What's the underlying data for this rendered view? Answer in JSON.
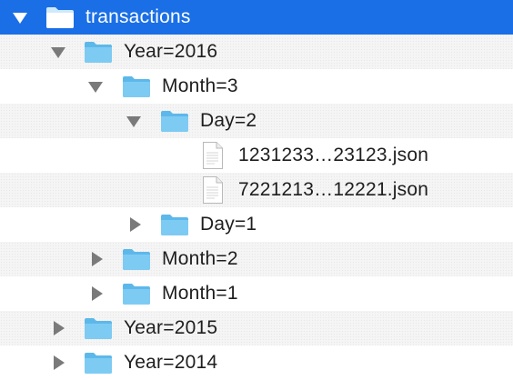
{
  "tree": {
    "root": {
      "label": "transactions",
      "icon": "folder-icon",
      "expanded": true,
      "selected": true
    },
    "year_2016": {
      "label": "Year=2016",
      "icon": "folder-icon",
      "expanded": true
    },
    "month_3": {
      "label": "Month=3",
      "icon": "folder-icon",
      "expanded": true
    },
    "day_2": {
      "label": "Day=2",
      "icon": "folder-icon",
      "expanded": true
    },
    "file_1": {
      "label": "1231233…23123.json",
      "icon": "json-file-icon"
    },
    "file_2": {
      "label": "7221213…12221.json",
      "icon": "json-file-icon"
    },
    "day_1": {
      "label": "Day=1",
      "icon": "folder-icon",
      "expanded": false
    },
    "month_2": {
      "label": "Month=2",
      "icon": "folder-icon",
      "expanded": false
    },
    "month_1": {
      "label": "Month=1",
      "icon": "folder-icon",
      "expanded": false
    },
    "year_2015": {
      "label": "Year=2015",
      "icon": "folder-icon",
      "expanded": false
    },
    "year_2014": {
      "label": "Year=2014",
      "icon": "folder-icon",
      "expanded": false
    }
  },
  "colors": {
    "selection": "#1a6fe6",
    "folder": "#7dcbf3",
    "disclosure": "#7a7a7a",
    "text": "#1e1e1e"
  }
}
